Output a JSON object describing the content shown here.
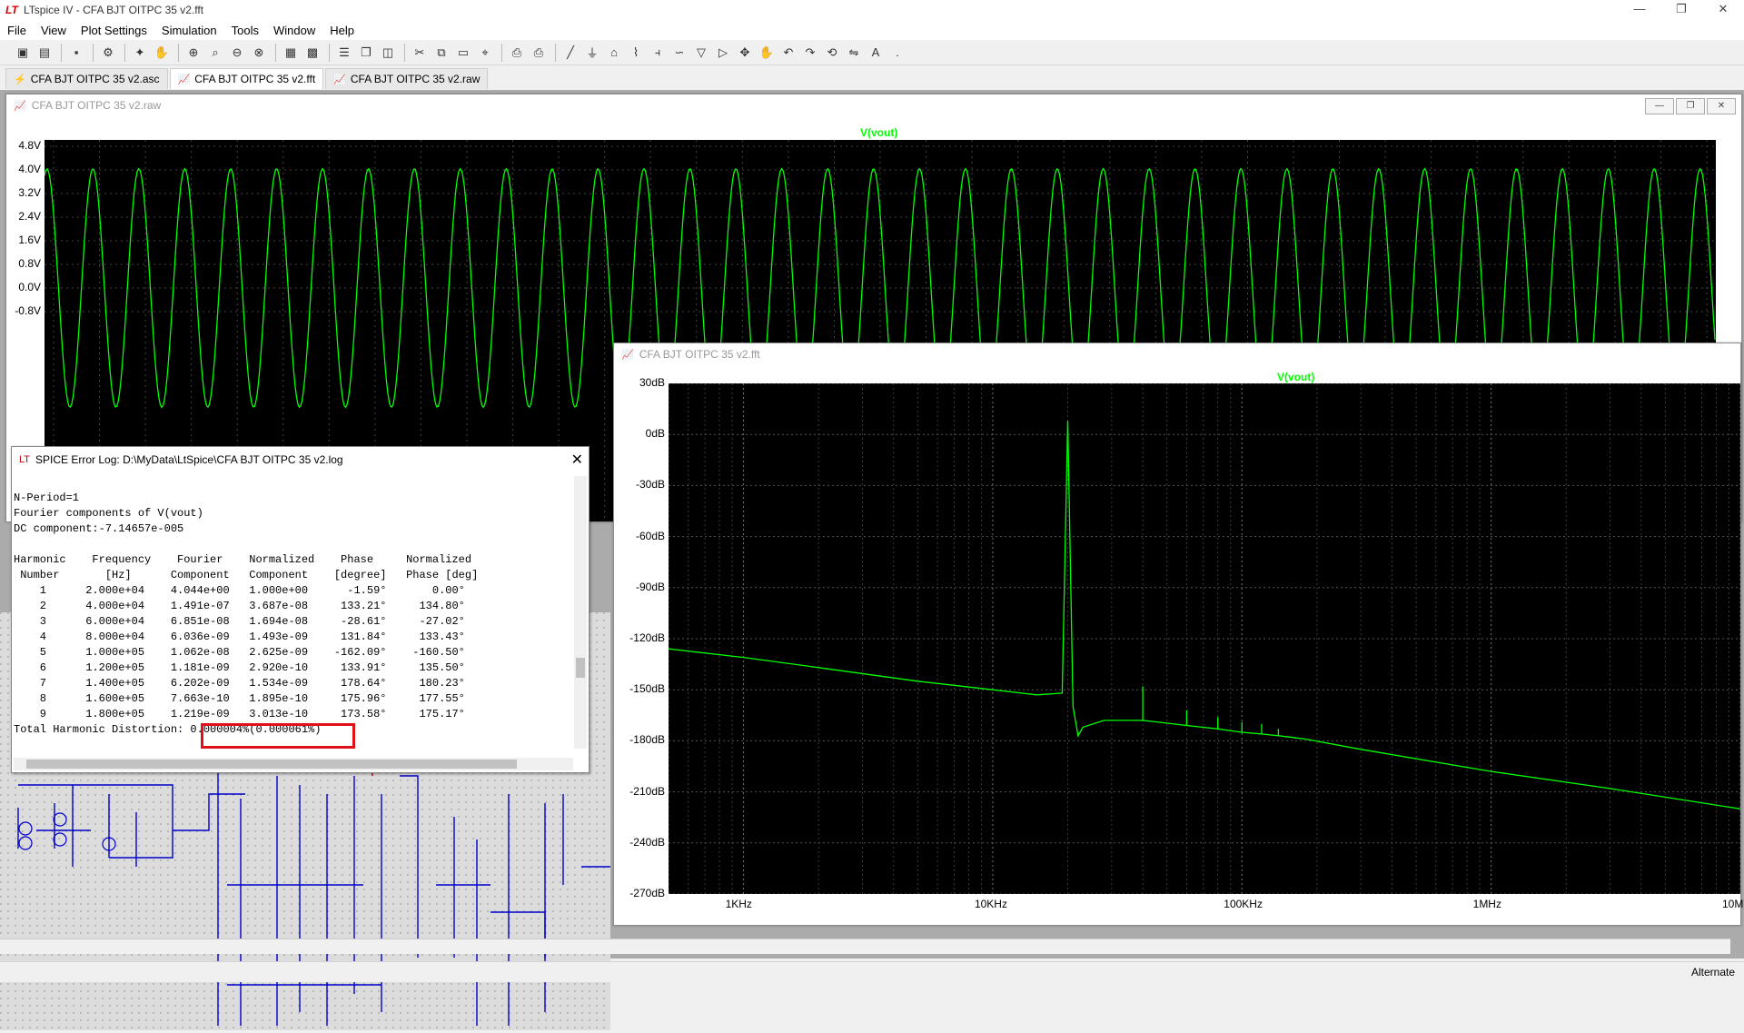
{
  "window": {
    "title": "LTspice IV - CFA BJT OITPC 35 v2.fft",
    "minimize": "—",
    "restore": "❐",
    "close": "✕"
  },
  "menu": [
    "File",
    "View",
    "Plot Settings",
    "Simulation",
    "Tools",
    "Window",
    "Help"
  ],
  "tabs": [
    {
      "label": "CFA BJT OITPC 35 v2.asc",
      "icon": "schematic-icon"
    },
    {
      "label": "CFA BJT OITPC 35 v2.fft",
      "icon": "waveform-icon"
    },
    {
      "label": "CFA BJT OITPC 35 v2.raw",
      "icon": "waveform-icon"
    }
  ],
  "raw_window": {
    "title": "CFA BJT OITPC 35 v2.raw",
    "trace": "V(vout)"
  },
  "fft_window": {
    "title": "CFA BJT OITPC 35 v2.fft",
    "trace": "V(vout)"
  },
  "chart_data": [
    {
      "type": "line",
      "title": "V(vout)",
      "ylabel": "V",
      "ytick_labels": [
        "4.8V",
        "4.0V",
        "3.2V",
        "2.4V",
        "1.6V",
        "0.8V",
        "0.0V",
        "-0.8V"
      ],
      "yticks": [
        4.8,
        4.0,
        3.2,
        2.4,
        1.6,
        0.8,
        0.0,
        -0.8
      ],
      "series": [
        {
          "name": "V(vout)",
          "color": "#00ff00",
          "cycles": 36,
          "peak": 4.04,
          "trough": -4.04
        }
      ],
      "grid": true
    },
    {
      "type": "line",
      "title": "V(vout)",
      "ytick_labels": [
        "30dB",
        "0dB",
        "-30dB",
        "-60dB",
        "-90dB",
        "-120dB",
        "-150dB",
        "-180dB",
        "-210dB",
        "-240dB",
        "-270dB"
      ],
      "yticks": [
        30,
        0,
        -30,
        -60,
        -90,
        -120,
        -150,
        -180,
        -210,
        -240,
        -270
      ],
      "xtick_labels": [
        "1KHz",
        "10KHz",
        "100KHz",
        "1MHz",
        "10MHz"
      ],
      "x_log": true,
      "xlim": [
        500,
        10000000
      ],
      "ylim": [
        -270,
        30
      ],
      "series": [
        {
          "name": "V(vout)",
          "color": "#00ff00",
          "points": [
            [
              500,
              -126
            ],
            [
              1000,
              -131
            ],
            [
              2000,
              -137
            ],
            [
              5000,
              -145
            ],
            [
              10000,
              -150
            ],
            [
              15000,
              -153
            ],
            [
              19000,
              -152
            ],
            [
              20000,
              8
            ],
            [
              21000,
              -160
            ],
            [
              22000,
              -177
            ],
            [
              23000,
              -172
            ],
            [
              28000,
              -168
            ],
            [
              40000,
              -168
            ],
            [
              40000,
              -148
            ],
            [
              40000,
              -168
            ],
            [
              60000,
              -171
            ],
            [
              60000,
              -162
            ],
            [
              60000,
              -171
            ],
            [
              80000,
              -173
            ],
            [
              80000,
              -166
            ],
            [
              80000,
              -173
            ],
            [
              100000,
              -175
            ],
            [
              100000,
              -169
            ],
            [
              100000,
              -175
            ],
            [
              120000,
              -176
            ],
            [
              120000,
              -170
            ],
            [
              120000,
              -176
            ],
            [
              140000,
              -177
            ],
            [
              140000,
              -173
            ],
            [
              140000,
              -177
            ],
            [
              160000,
              -178
            ],
            [
              180000,
              -179
            ],
            [
              300000,
              -185
            ],
            [
              1000000,
              -198
            ],
            [
              3000000,
              -208
            ],
            [
              10000000,
              -220
            ]
          ]
        }
      ],
      "grid": true
    }
  ],
  "errlog": {
    "title": "SPICE Error Log: D:\\MyData\\LtSpice\\CFA BJT OITPC 35 v2.log",
    "close": "✕",
    "lines": [
      "N-Period=1",
      "Fourier components of V(vout)",
      "DC component:-7.14657e-005",
      "",
      "Harmonic    Frequency    Fourier    Normalized    Phase     Normalized",
      " Number       [Hz]      Component   Component    [degree]   Phase [deg]",
      "    1      2.000e+04    4.044e+00   1.000e+00      -1.59°       0.00°",
      "    2      4.000e+04    1.491e-07   3.687e-08     133.21°     134.80°",
      "    3      6.000e+04    6.851e-08   1.694e-08     -28.61°     -27.02°",
      "    4      8.000e+04    6.036e-09   1.493e-09     131.84°     133.43°",
      "    5      1.000e+05    1.062e-08   2.625e-09    -162.09°    -160.50°",
      "    6      1.200e+05    1.181e-09   2.920e-10     133.91°     135.50°",
      "    7      1.400e+05    6.202e-09   1.534e-09     178.64°     180.23°",
      "    8      1.600e+05    7.663e-10   1.895e-10     175.96°     177.55°",
      "    9      1.800e+05    1.219e-09   3.013e-10     173.58°     175.17°",
      "Total Harmonic Distortion: 0.000004%(0.000061%)"
    ]
  },
  "status": {
    "text": "Alternate"
  }
}
